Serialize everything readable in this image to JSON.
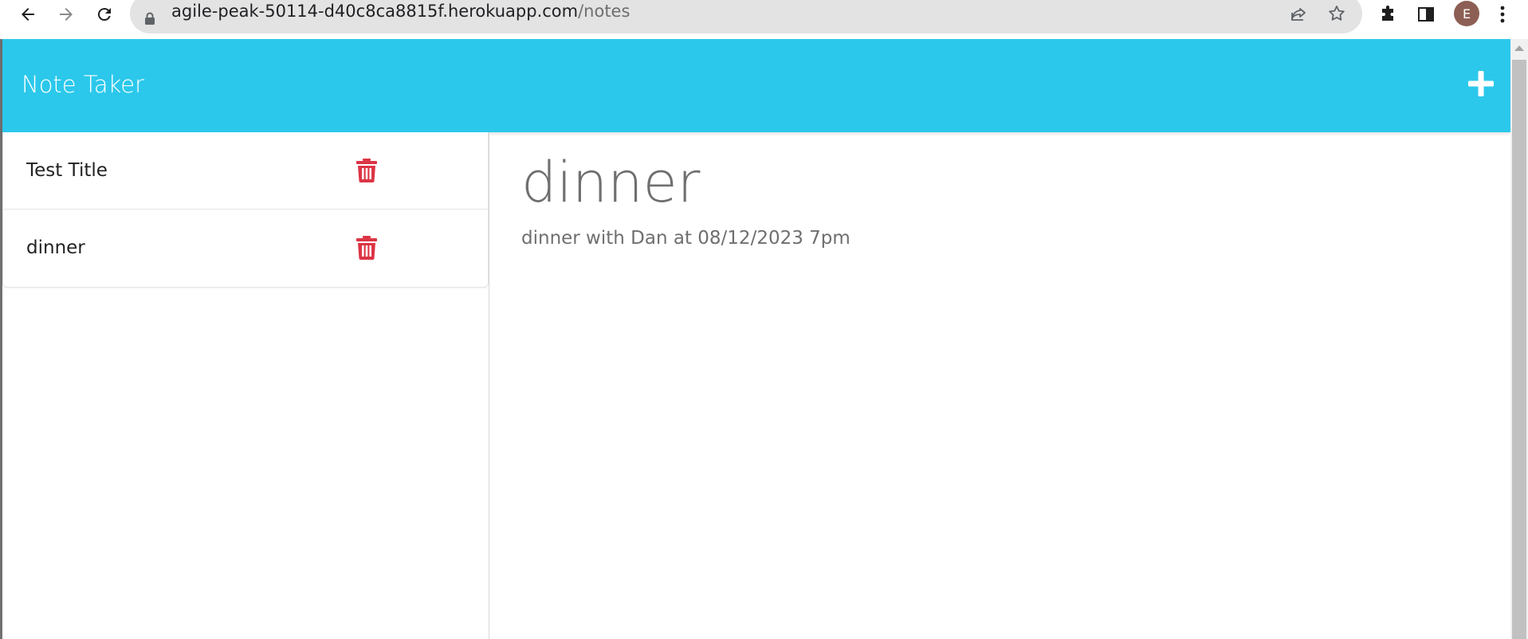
{
  "browser": {
    "url_domain": "agile-peak-50114-d40c8ca8815f.herokuapp.com",
    "url_path": "/notes",
    "profile_initial": "E",
    "icons": [
      "back-icon",
      "forward-icon",
      "reload-icon",
      "lock-icon",
      "share-icon",
      "star-icon",
      "extensions-icon",
      "side-panel-icon",
      "menu-icon"
    ]
  },
  "app": {
    "brand": "Note Taker",
    "new_note_icon": "plus-icon",
    "accent_color": "#2bc8eb",
    "delete_color": "#dc3545"
  },
  "notes": [
    {
      "title": "Test Title"
    },
    {
      "title": "dinner"
    }
  ],
  "active_note": {
    "title": "dinner",
    "text": "dinner with Dan at 08/12/2023 7pm"
  }
}
